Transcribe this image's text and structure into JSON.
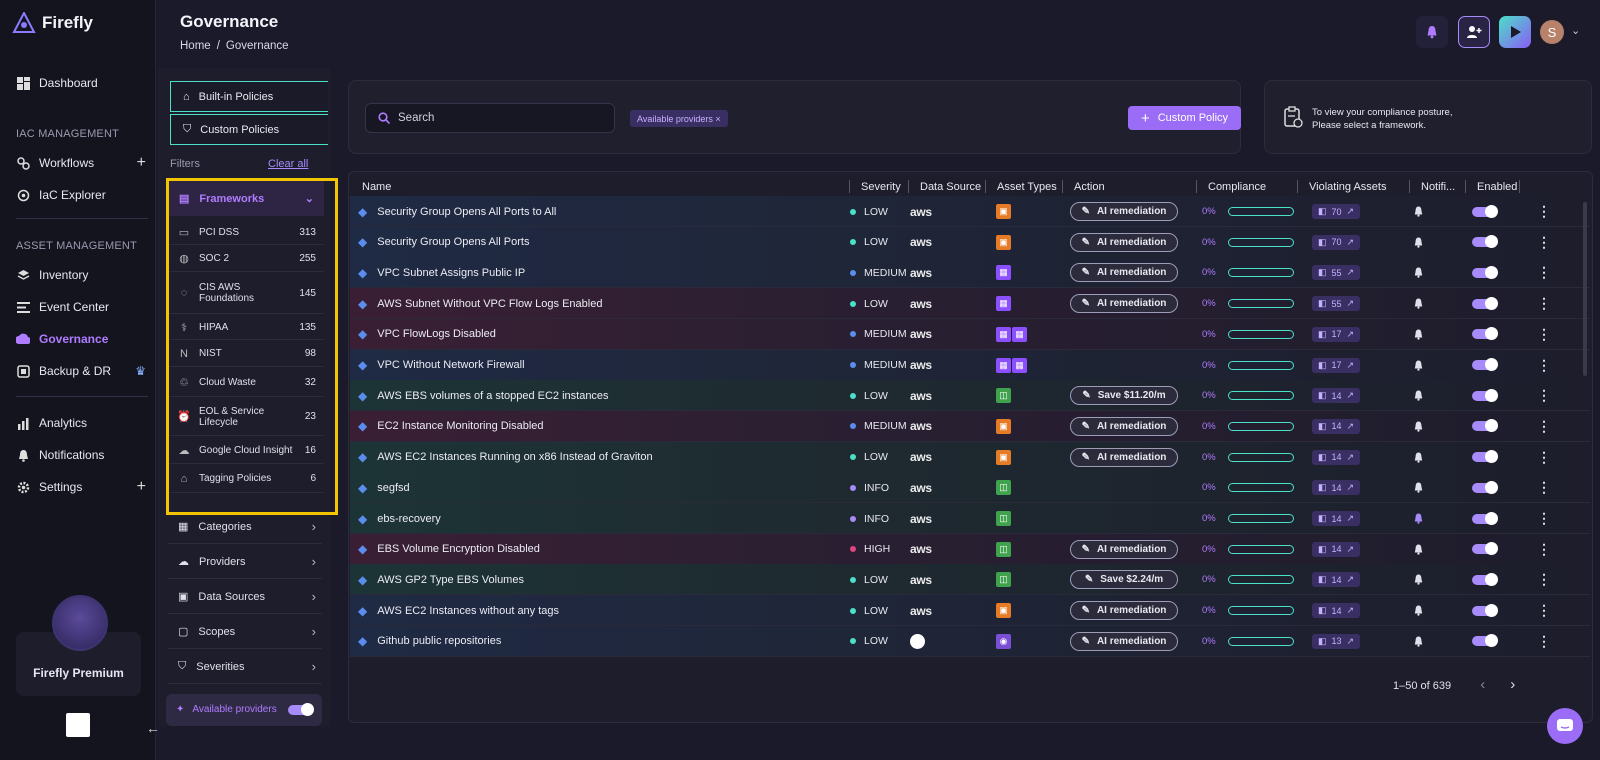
{
  "app": {
    "name": "Firefly"
  },
  "nav": {
    "dashboard": "Dashboard",
    "iac_section": "IAC MANAGEMENT",
    "workflows": "Workflows",
    "iac_explorer": "IaC Explorer",
    "asset_section": "ASSET MANAGEMENT",
    "inventory": "Inventory",
    "event_center": "Event Center",
    "governance": "Governance",
    "backup": "Backup & DR",
    "analytics": "Analytics",
    "notifications": "Notifications",
    "settings": "Settings",
    "premium": "Firefly Premium"
  },
  "header": {
    "title": "Governance",
    "crumb_home": "Home",
    "crumb_sep": "/",
    "crumb_current": "Governance",
    "avatar": "S"
  },
  "policy_tabs": {
    "builtin": "Built-in Policies",
    "custom": "Custom Policies"
  },
  "filters": {
    "label": "Filters",
    "clear": "Clear all",
    "frameworks_label": "Frameworks",
    "frameworks": [
      {
        "name": "PCI DSS",
        "count": "313",
        "icon": "card-icon"
      },
      {
        "name": "SOC 2",
        "count": "255",
        "icon": "globe-icon"
      },
      {
        "name": "CIS AWS Foundations",
        "count": "145",
        "icon": "cis-icon"
      },
      {
        "name": "HIPAA",
        "count": "135",
        "icon": "caduceus-icon"
      },
      {
        "name": "NIST",
        "count": "98",
        "icon": "nist-icon"
      },
      {
        "name": "Cloud Waste",
        "count": "32",
        "icon": "waste-icon"
      },
      {
        "name": "EOL & Service Lifecycle",
        "count": "23",
        "icon": "clock-icon"
      },
      {
        "name": "Google Cloud Insight",
        "count": "16",
        "icon": "cloud-icon"
      },
      {
        "name": "Tagging Policies",
        "count": "6",
        "icon": "tag-icon"
      }
    ],
    "categories": "Categories",
    "providers": "Providers",
    "data_sources": "Data Sources",
    "scopes": "Scopes",
    "severities": "Severities",
    "available_providers": "Available providers"
  },
  "search": {
    "placeholder": "Search",
    "chip": "Available providers ×",
    "custom_policy": "Custom Policy"
  },
  "posture": {
    "line1": "To view your compliance posture,",
    "line2": "Please select a framework."
  },
  "table": {
    "headers": {
      "name": "Name",
      "severity": "Severity",
      "data_source": "Data Source",
      "asset_types": "Asset Types",
      "action": "Action",
      "compliance": "Compliance",
      "violating": "Violating Assets",
      "notifi": "Notifi...",
      "enabled": "Enabled"
    },
    "rows": [
      {
        "name": "Security Group Opens All Ports to All",
        "severity": "LOW",
        "source": "aws",
        "assets": [
          "ec2"
        ],
        "action": "AI remediation",
        "compliance": "0%",
        "violating": "70",
        "tint": "g1"
      },
      {
        "name": "Security Group Opens All Ports",
        "severity": "LOW",
        "source": "aws",
        "assets": [
          "ec2"
        ],
        "action": "AI remediation",
        "compliance": "0%",
        "violating": "70",
        "tint": "g1"
      },
      {
        "name": "VPC Subnet Assigns Public IP",
        "severity": "MEDIUM",
        "source": "aws",
        "assets": [
          "vpc"
        ],
        "action": "AI remediation",
        "compliance": "0%",
        "violating": "55",
        "tint": "g1"
      },
      {
        "name": "AWS Subnet Without VPC Flow Logs Enabled",
        "severity": "LOW",
        "source": "aws",
        "assets": [
          "vpc"
        ],
        "action": "AI remediation",
        "compliance": "0%",
        "violating": "55",
        "tint": "g2"
      },
      {
        "name": "VPC FlowLogs Disabled",
        "severity": "MEDIUM",
        "source": "aws",
        "assets": [
          "vpc",
          "vpc"
        ],
        "action": "",
        "compliance": "0%",
        "violating": "17",
        "tint": "g2"
      },
      {
        "name": "VPC Without Network Firewall",
        "severity": "MEDIUM",
        "source": "aws",
        "assets": [
          "vpc",
          "vpc"
        ],
        "action": "",
        "compliance": "0%",
        "violating": "17",
        "tint": "g1"
      },
      {
        "name": "AWS EBS volumes of a stopped EC2 instances",
        "severity": "LOW",
        "source": "aws",
        "assets": [
          "ebs"
        ],
        "action": "Save $11.20/m",
        "compliance": "0%",
        "violating": "14",
        "tint": "g3"
      },
      {
        "name": "EC2 Instance Monitoring Disabled",
        "severity": "MEDIUM",
        "source": "aws",
        "assets": [
          "ec2"
        ],
        "action": "AI remediation",
        "compliance": "0%",
        "violating": "14",
        "tint": "g2"
      },
      {
        "name": "AWS EC2 Instances Running on x86 Instead of Graviton",
        "severity": "LOW",
        "source": "aws",
        "assets": [
          "ec2"
        ],
        "action": "AI remediation",
        "compliance": "0%",
        "violating": "14",
        "tint": "g3"
      },
      {
        "name": "segfsd",
        "severity": "INFO",
        "source": "aws",
        "assets": [
          "ebs"
        ],
        "action": "",
        "compliance": "0%",
        "violating": "14",
        "tint": "g3"
      },
      {
        "name": "ebs-recovery",
        "severity": "INFO",
        "source": "aws",
        "assets": [
          "ebs"
        ],
        "action": "",
        "compliance": "0%",
        "violating": "14",
        "tint": "g3"
      },
      {
        "name": "EBS Volume Encryption Disabled",
        "severity": "HIGH",
        "source": "aws",
        "assets": [
          "ebs"
        ],
        "action": "AI remediation",
        "compliance": "0%",
        "violating": "14",
        "tint": "g2"
      },
      {
        "name": "AWS GP2 Type EBS Volumes",
        "severity": "LOW",
        "source": "aws",
        "assets": [
          "ebs"
        ],
        "action": "Save $2.24/m",
        "compliance": "0%",
        "violating": "14",
        "tint": "g3"
      },
      {
        "name": "AWS EC2 Instances without any tags",
        "severity": "LOW",
        "source": "aws",
        "assets": [
          "ec2"
        ],
        "action": "AI remediation",
        "compliance": "0%",
        "violating": "14",
        "tint": "g1"
      },
      {
        "name": "Github public repositories",
        "severity": "LOW",
        "source": "github",
        "assets": [
          "gh"
        ],
        "action": "AI remediation",
        "compliance": "0%",
        "violating": "13",
        "tint": "g1"
      }
    ]
  },
  "pagination": {
    "label": "1–50 of 639"
  },
  "colors": {
    "accent": "#9b6cf5",
    "teal": "#4be0c8",
    "low": "#4be0c8",
    "medium": "#5b8def",
    "high": "#e0457b",
    "info": "#a78bfa",
    "highlight": "#f2c500"
  }
}
